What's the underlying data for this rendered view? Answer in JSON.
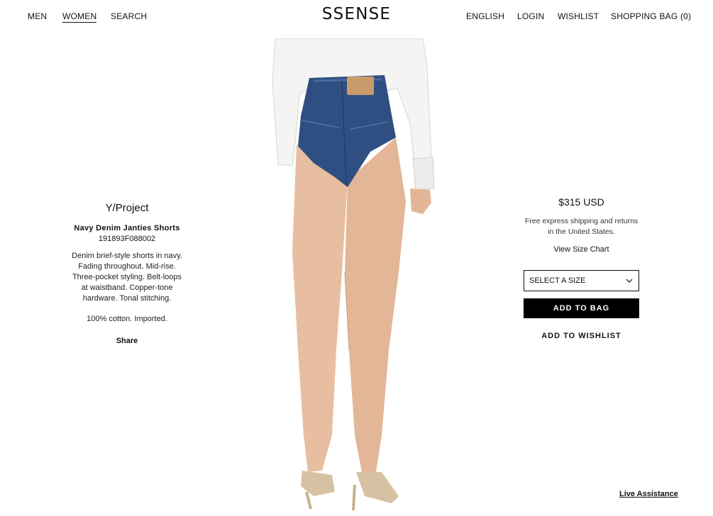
{
  "header": {
    "nav_left": [
      "MEN",
      "WOMEN",
      "SEARCH"
    ],
    "logo": "SSENSE",
    "nav_right": [
      "ENGLISH",
      "LOGIN",
      "WISHLIST",
      "SHOPPING BAG (0)"
    ],
    "active_item": "WOMEN"
  },
  "product": {
    "brand": "Y/Project",
    "name": "Navy Denim Janties Shorts",
    "sku": "191893F088002",
    "description": "Denim brief-style shorts in navy. Fading throughout. Mid-rise. Three-pocket styling. Belt-loops at waistband. Copper-tone hardware. Tonal stitching.",
    "material": "100% cotton. Imported.",
    "share_label": "Share"
  },
  "purchase": {
    "price": "$315 USD",
    "shipping": "Free express shipping and returns in the United States.",
    "size_chart_label": "View Size Chart",
    "size_select": "SELECT A SIZE",
    "add_to_bag": "ADD TO BAG",
    "add_to_wishlist": "ADD TO WISHLIST"
  },
  "live_assistance": "Live Assistance",
  "colors": {
    "text": "#111111",
    "button_bg": "#000000",
    "button_text": "#ffffff",
    "background": "#ffffff"
  }
}
